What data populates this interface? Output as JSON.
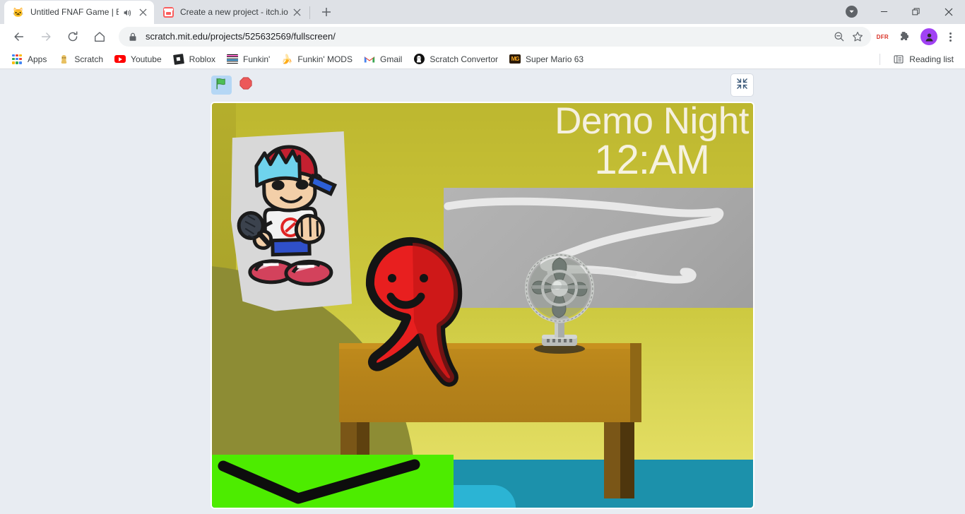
{
  "browser": {
    "tabs": [
      {
        "title": "Untitled FNAF Game | Early A",
        "favicon": "scratch-favicon",
        "active": true,
        "audio_icon": "speaker-icon",
        "close_icon": "close-icon"
      },
      {
        "title": "Create a new project - itch.io",
        "favicon": "itchio-favicon",
        "active": false,
        "close_icon": "close-icon"
      }
    ],
    "new_tab_label": "+",
    "window_controls": {
      "update_icon": "update-available-icon",
      "minimize": "—",
      "maximize": "maximize-icon",
      "close": "✕"
    },
    "toolbar": {
      "back_icon": "back-arrow-icon",
      "forward_icon": "forward-arrow-icon",
      "reload_icon": "reload-icon",
      "home_icon": "home-icon",
      "lock_icon": "lock-icon",
      "url": "scratch.mit.edu/projects/525632569/fullscreen/",
      "zoom_icon": "zoom-out-icon",
      "bookmark_icon": "star-icon",
      "extension_dfr_label": "DFR",
      "extensions_icon": "puzzle-piece-icon",
      "profile_icon": "profile-avatar",
      "menu_icon": "three-dot-menu-icon",
      "accent_color": "#a142f4"
    },
    "bookmarks": [
      {
        "label": "Apps",
        "icon": "apps-grid-icon"
      },
      {
        "label": "Scratch",
        "icon": "scratch-cat-icon"
      },
      {
        "label": "Youtube",
        "icon": "youtube-icon"
      },
      {
        "label": "Roblox",
        "icon": "roblox-icon"
      },
      {
        "label": "Funkin'",
        "icon": "fnf-icon"
      },
      {
        "label": "Funkin' MODS",
        "icon": "banana-icon"
      },
      {
        "label": "Gmail",
        "icon": "gmail-icon"
      },
      {
        "label": "Scratch Convertor",
        "icon": "scratch-convertor-icon"
      },
      {
        "label": "Super Mario 63",
        "icon": "mario-icon"
      }
    ],
    "reading_list": {
      "label": "Reading list",
      "icon": "reading-list-icon"
    }
  },
  "player": {
    "green_flag": {
      "name": "green-flag-button",
      "icon": "green-flag-icon",
      "active": true,
      "color": "#4cbf56",
      "highlight": "#b5d7f5"
    },
    "stop_button": {
      "name": "stop-button",
      "icon": "stop-sign-icon",
      "color": "#ec5959"
    },
    "fullscreen_button": {
      "name": "exit-fullscreen-button",
      "icon": "exit-fullscreen-icon"
    }
  },
  "stage": {
    "title": "Demo Night",
    "time": "12:AM",
    "title_color": "#f5f0df",
    "background_color": "#c5bf35",
    "floor_color": "#1c91ab",
    "desk_color": "#b5821a",
    "banner_color": "#4dec00",
    "character_color": "#e81f1f",
    "window_panel_color": "#aeaeae",
    "sprites": [
      {
        "name": "boyfriend-poster",
        "description": "Friday Night Funkin Boyfriend poster on white paper"
      },
      {
        "name": "red-blob-character",
        "description": "Red blob character with dot eyes and smile"
      },
      {
        "name": "desk-fan",
        "description": "Vintage metal oscillating fan"
      },
      {
        "name": "wooden-desk",
        "description": "Wooden desk with two legs"
      },
      {
        "name": "green-banner",
        "description": "Bright green rectangle with black V checkmark"
      },
      {
        "name": "white-squiggle",
        "description": "White squiggly lines on gray wall panel"
      }
    ]
  }
}
